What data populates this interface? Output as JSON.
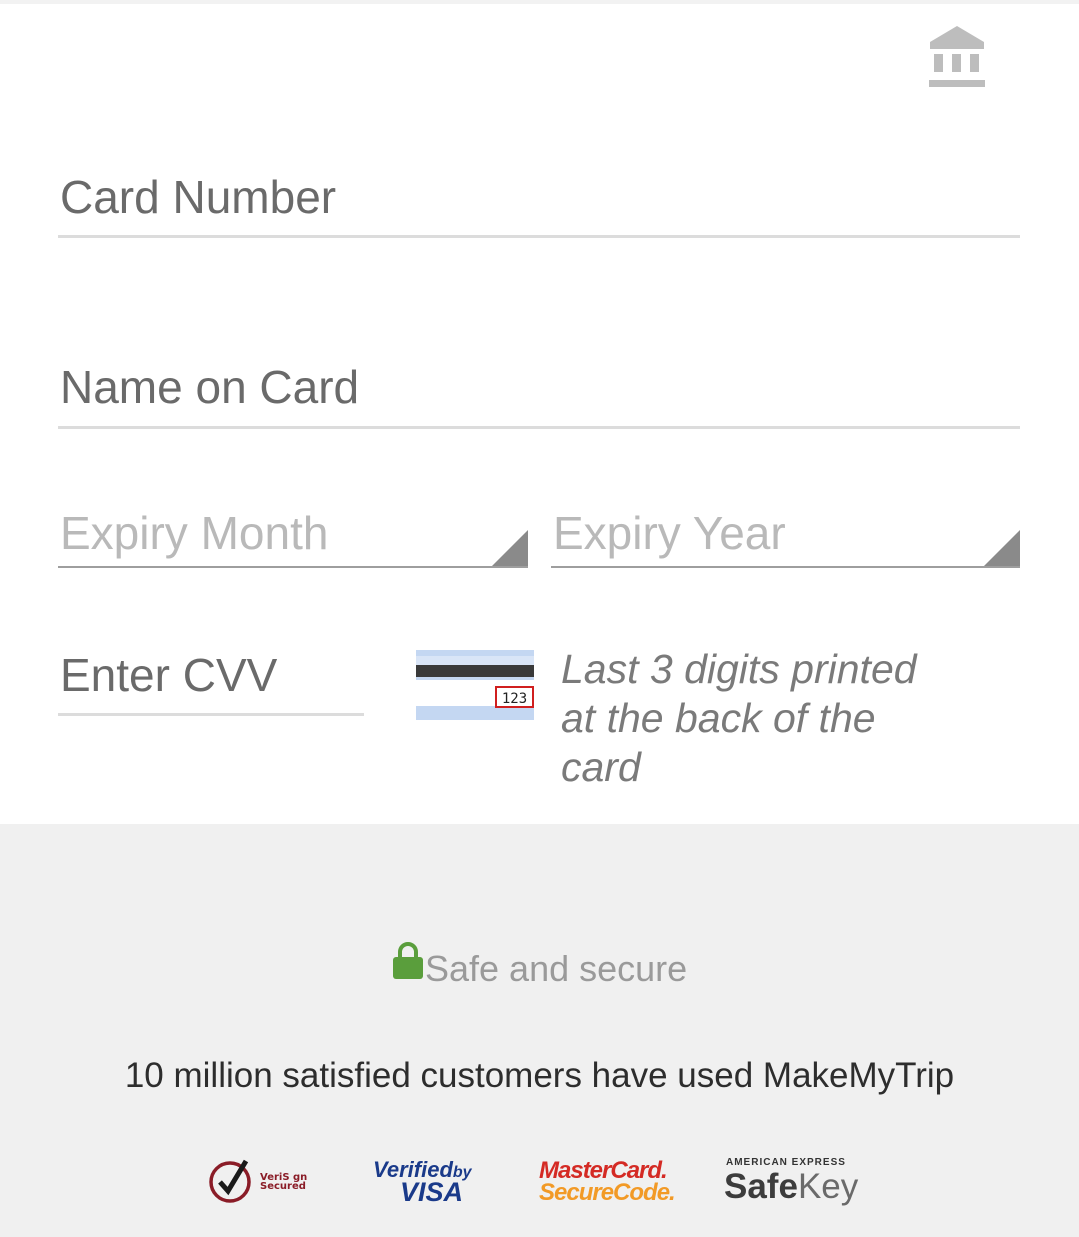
{
  "form": {
    "card_number_placeholder": "Card Number",
    "name_on_card_placeholder": "Name on Card",
    "expiry_month_placeholder": "Expiry Month",
    "expiry_year_placeholder": "Expiry Year",
    "cvv_placeholder": "Enter CVV",
    "cvv_card_digits": "123",
    "cvv_hint": "Last 3 digits printed at the back of the card"
  },
  "footer": {
    "secure_label": "Safe and secure",
    "customers_text": "10 million satisfied customers have used MakeMyTrip",
    "badges": {
      "verisign_line1": "VeriS gn",
      "verisign_line2": "Secured",
      "visa_line1": "Verified",
      "visa_by": "by",
      "visa_line2": "VISA",
      "mastercard_line1": "MasterCard.",
      "mastercard_line2": "SecureCode.",
      "amex_line1": "AMERICAN EXPRESS",
      "amex_safe": "Safe",
      "amex_key": "Key"
    }
  },
  "icons": {
    "bank": "bank-icon",
    "lock": "lock-icon",
    "dropdown": "dropdown-corner-icon"
  },
  "colors": {
    "lock_green": "#5a9e3c",
    "mastercard_red": "#d42a24",
    "mastercard_orange": "#f29a26",
    "visa_blue": "#1a3a8a",
    "verisign_red": "#8a1c27"
  }
}
